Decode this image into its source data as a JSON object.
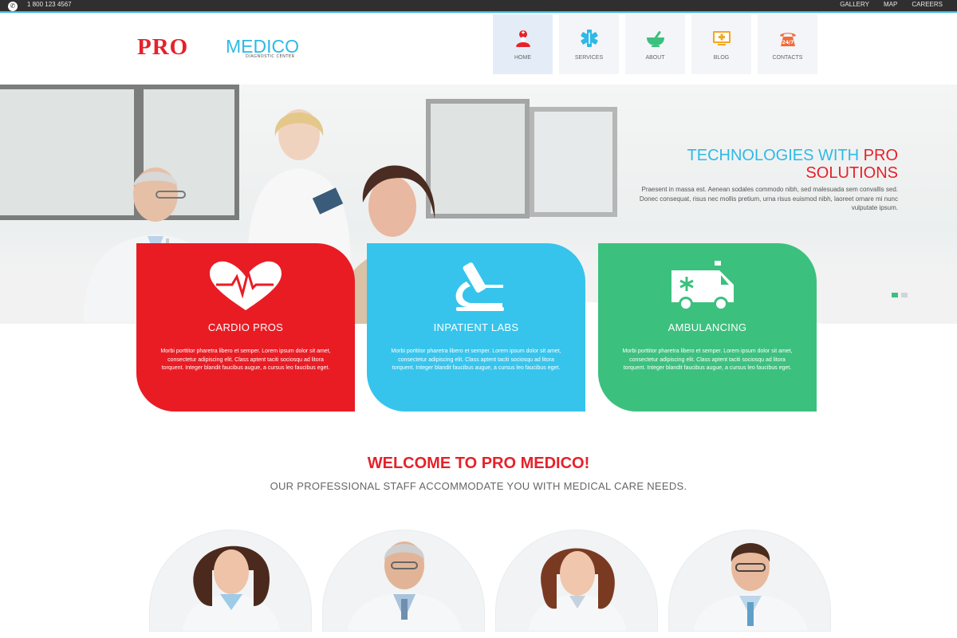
{
  "topbar": {
    "phone_icon": "phone-icon",
    "phone": "1 800 123 4567",
    "links": [
      "GALLERY",
      "MAP",
      "CAREERS"
    ]
  },
  "logo": {
    "pro": "PRO",
    "medico": "MEDICO",
    "tagline": "DIAGNOSTIC CENTER"
  },
  "nav": [
    {
      "label": "HOME",
      "icon": "nurse-icon",
      "color": "#e6212a"
    },
    {
      "label": "SERVICES",
      "icon": "star-of-life-icon",
      "color": "#2fb9e6"
    },
    {
      "label": "ABOUT",
      "icon": "mortar-pestle-icon",
      "color": "#3cc07e"
    },
    {
      "label": "BLOG",
      "icon": "monitor-plus-icon",
      "color": "#f5a623"
    },
    {
      "label": "CONTACTS",
      "icon": "phone-24-7-icon",
      "color": "#f26b3a"
    }
  ],
  "hero": {
    "title_part1": "TECHNOLOGIES WITH",
    "title_pro": "PRO",
    "title_part2": "SOLUTIONS",
    "text": "Praesent in massa est. Aenean sodales commodo nibh, sed malesuada sem convallis sed. Donec consequat, risus nec mollis pretium, urna risus euismod nibh, laoreet ornare mi nunc vulputate ipsum.",
    "slides": 2
  },
  "cards": [
    {
      "title": "CARDIO PROS",
      "icon": "heart-pulse-icon",
      "color": "#e91c24",
      "text": "Morbi porttitor pharetra libero et semper. Lorem ipsum dolor sit amet, consectetur adipiscing elit. Class aptent taciti sociosqu ad litora torquent. Integer blandit faucibus augue, a cursus leo faucibus eget."
    },
    {
      "title": "INPATIENT LABS",
      "icon": "microscope-icon",
      "color": "#36c4ec",
      "text": "Morbi porttitor pharetra libero et semper. Lorem ipsum dolor sit amet, consectetur adipiscing elit. Class aptent taciti sociosqu ad litora torquent. Integer blandit faucibus augue, a cursus leo faucibus eget."
    },
    {
      "title": "AMBULANCING",
      "icon": "ambulance-icon",
      "color": "#3cc07e",
      "text": "Morbi porttitor pharetra libero et semper. Lorem ipsum dolor sit amet, consectetur adipiscing elit. Class aptent taciti sociosqu ad litora torquent. Integer blandit faucibus augue, a cursus leo faucibus eget."
    }
  ],
  "welcome": {
    "title": "WELCOME TO PRO MEDICO!",
    "subtitle": "OUR PROFESSIONAL STAFF ACCOMMODATE YOU WITH MEDICAL CARE NEEDS."
  }
}
